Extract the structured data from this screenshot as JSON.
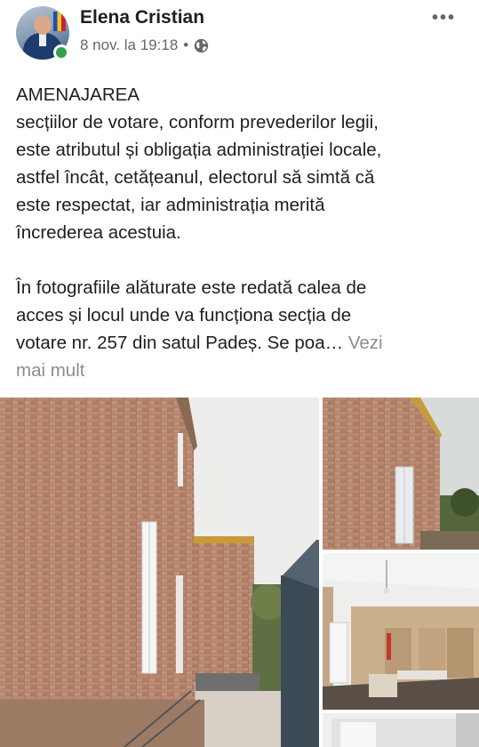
{
  "post": {
    "author": "Elena Cristian",
    "timestamp": "8 nov. la 19:18",
    "separator": "•",
    "privacy_icon": "globe-icon",
    "more_icon": "more-options-icon",
    "more_label": "•••",
    "text_lines_p1": [
      "AMENAJAREA",
      "secțiilor de votare, conform prevederilor legii,",
      "este atributul și obligația administrației locale,",
      "astfel încât, cetățeanul, electorul să simtă că",
      "este respectat, iar administrația merită",
      "încrederea acestuia."
    ],
    "text_lines_p2": [
      "În fotografiile alăturate este redată calea de",
      "acces și locul unde va funcționa secția de",
      "votare nr. 257 din satul Padeș. Se poa…"
    ],
    "see_more_line1": "Vezi",
    "see_more_line2": "mai mult"
  },
  "colors": {
    "text": "#1c1e21",
    "secondary": "#65676b",
    "see_more": "#8a8d91",
    "online": "#31a24c",
    "brick": "#b07d66",
    "sky": "#ececec"
  }
}
